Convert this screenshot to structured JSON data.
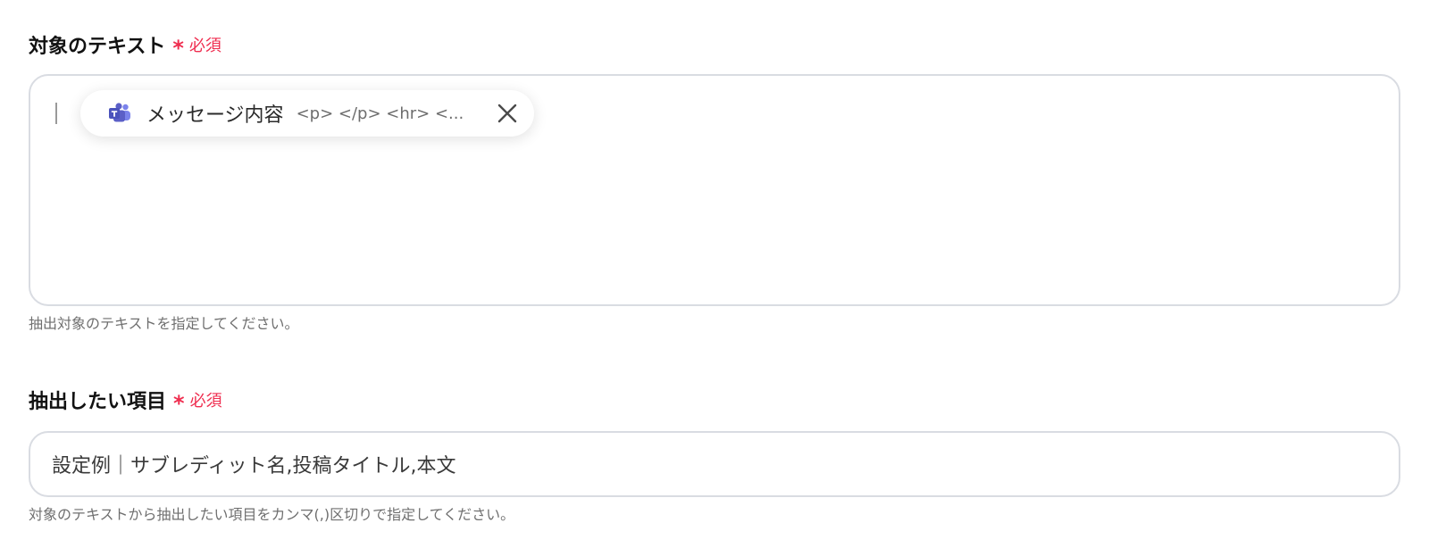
{
  "field1": {
    "label": "対象のテキスト",
    "required_star": "*",
    "required_text": "必須",
    "chip": {
      "icon": "microsoft-teams-icon",
      "label": "メッセージ内容",
      "value": "<p> </p> <hr> <..."
    },
    "help_text": "抽出対象のテキストを指定してください。"
  },
  "field2": {
    "label": "抽出したい項目",
    "required_star": "*",
    "required_text": "必須",
    "placeholder": "設定例｜サブレディット名,投稿タイトル,本文",
    "help_text": "対象のテキストから抽出したい項目をカンマ(,)区切りで指定してください。"
  },
  "colors": {
    "required": "#ef2d4f",
    "teams_purple": "#5b5fc7",
    "border": "#d9dce2",
    "help_text": "#6f6f6f"
  }
}
